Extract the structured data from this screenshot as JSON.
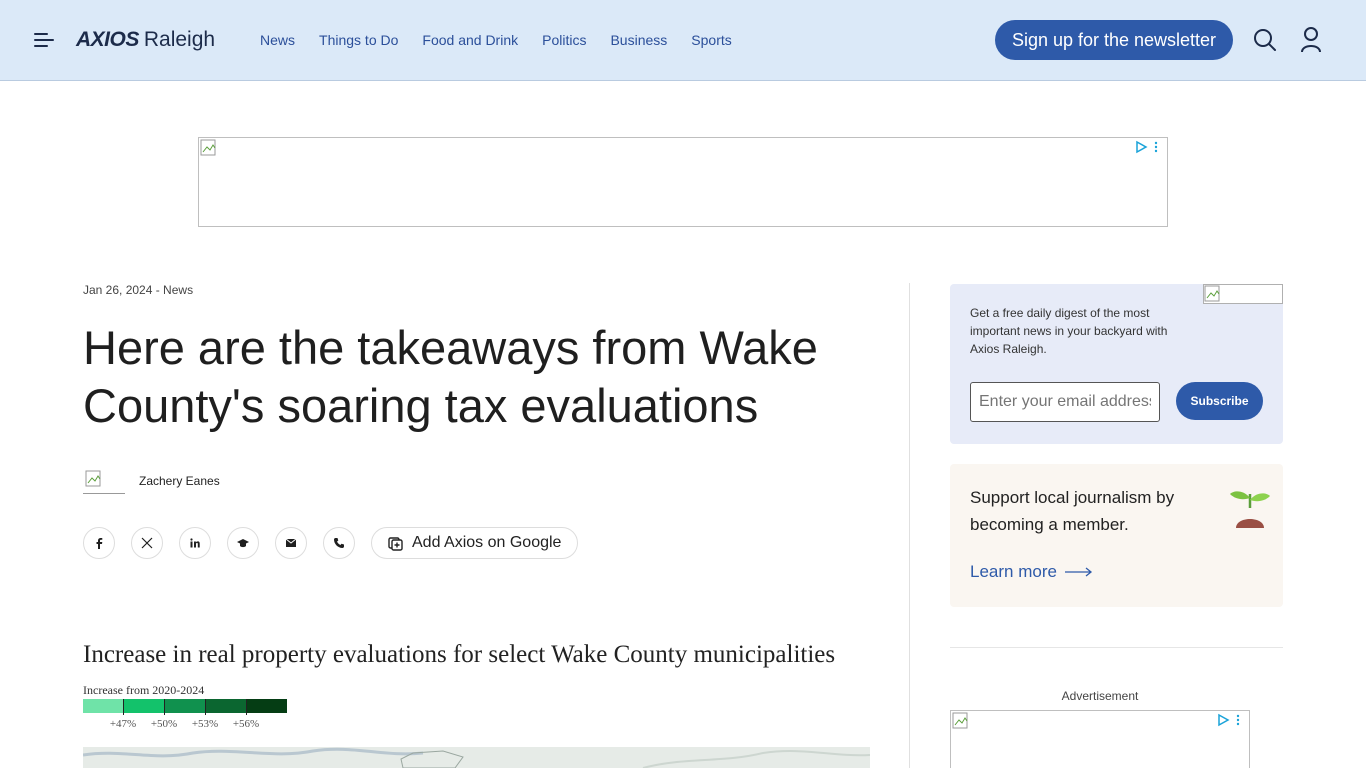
{
  "header": {
    "logo_brand": "AXIOS",
    "logo_city": "Raleigh",
    "nav": [
      "News",
      "Things to Do",
      "Food and Drink",
      "Politics",
      "Business",
      "Sports"
    ],
    "signup_label": "Sign up for the newsletter",
    "accent_color": "#2e5aa9",
    "background_color": "#dbe9f8"
  },
  "article": {
    "meta": "Jan 26, 2024 - News",
    "headline": "Here are the takeaways from Wake County's soaring tax evaluations",
    "author": "Zachery Eanes",
    "share_icons": [
      "facebook-icon",
      "x-icon",
      "linkedin-icon",
      "threads-icon",
      "email-icon",
      "phone-icon"
    ],
    "google_label": "Add Axios on Google"
  },
  "chart": {
    "title": "Increase in real property evaluations for select Wake County municipalities",
    "legend_label": "Increase from 2020-2024",
    "legend_ticks": [
      "+47%",
      "+50%",
      "+53%",
      "+56%"
    ],
    "legend_colors": [
      "#6fe3a8",
      "#13c26b",
      "#10914e",
      "#0b6630",
      "#053d14"
    ]
  },
  "sidebar": {
    "newsletter_text": "Get a free daily digest of the most important news in your backyard with Axios Raleigh.",
    "email_placeholder": "Enter your email address",
    "subscribe_label": "Subscribe",
    "support_text": "Support local journalism by becoming a member.",
    "learn_more": "Learn more",
    "ad_label": "Advertisement"
  }
}
